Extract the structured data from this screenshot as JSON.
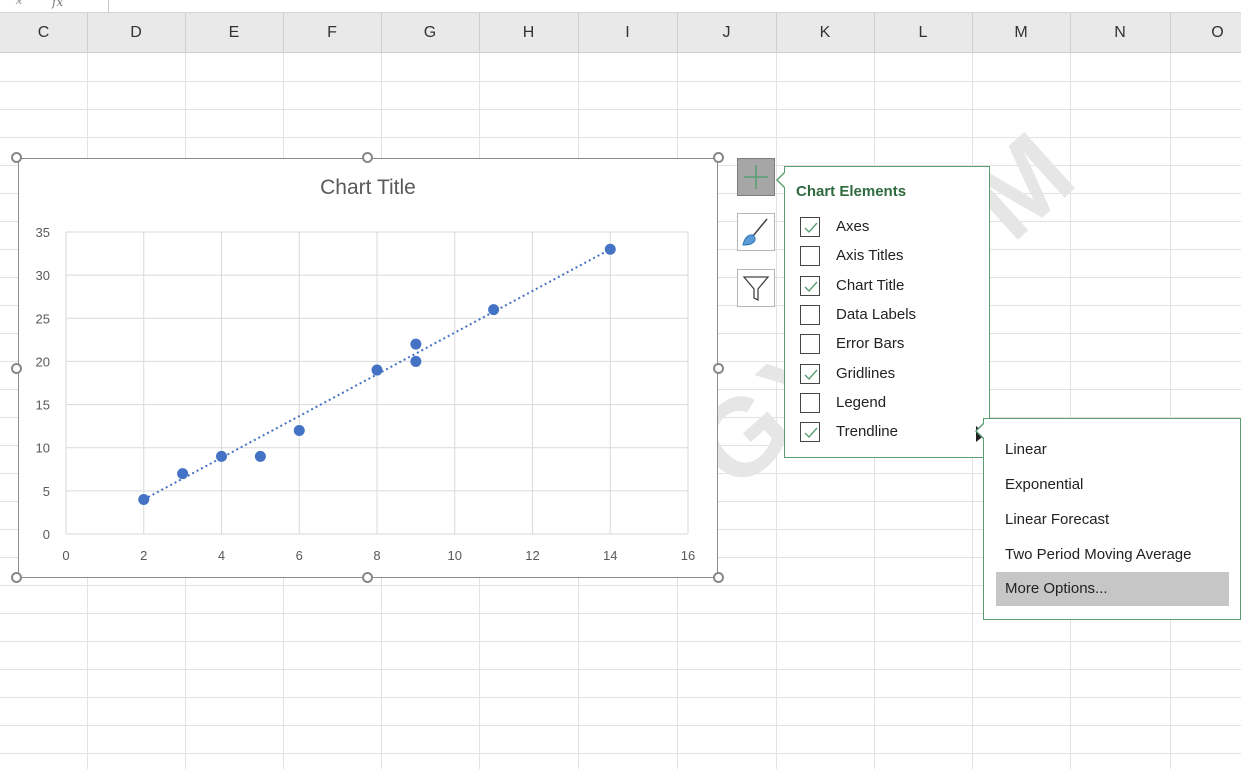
{
  "columns": [
    "C",
    "D",
    "E",
    "F",
    "G",
    "H",
    "I",
    "J",
    "K",
    "L",
    "M",
    "N",
    "O"
  ],
  "chart": {
    "title": "Chart Title"
  },
  "chart_data": {
    "type": "scatter",
    "title": "Chart Title",
    "xlabel": "",
    "ylabel": "",
    "xlim": [
      0,
      16
    ],
    "ylim": [
      0,
      35
    ],
    "x_ticks": [
      0,
      2,
      4,
      6,
      8,
      10,
      12,
      14,
      16
    ],
    "y_ticks": [
      0,
      5,
      10,
      15,
      20,
      25,
      30,
      35
    ],
    "grid": true,
    "legend": false,
    "series": [
      {
        "x": [
          2,
          3,
          4,
          5,
          6,
          8,
          9,
          9,
          11,
          14
        ],
        "y": [
          4,
          7,
          9,
          9,
          12,
          19,
          22,
          20,
          26,
          33
        ],
        "color": "#4472c4"
      }
    ],
    "trendline": {
      "type": "linear",
      "style": "dotted",
      "color": "#4472c4",
      "from": [
        2,
        4
      ],
      "to": [
        14,
        33
      ]
    }
  },
  "side_buttons": {
    "elements_icon": "plus-icon",
    "styles_icon": "brush-icon",
    "filter_icon": "funnel-icon"
  },
  "chart_elements": {
    "title": "Chart Elements",
    "items": [
      {
        "label": "Axes",
        "checked": true
      },
      {
        "label": "Axis Titles",
        "checked": false
      },
      {
        "label": "Chart Title",
        "checked": true
      },
      {
        "label": "Data Labels",
        "checked": false
      },
      {
        "label": "Error Bars",
        "checked": false
      },
      {
        "label": "Gridlines",
        "checked": true
      },
      {
        "label": "Legend",
        "checked": false
      },
      {
        "label": "Trendline",
        "checked": true
      }
    ]
  },
  "trendline_menu": {
    "items": [
      "Linear",
      "Exponential",
      "Linear Forecast",
      "Two Period Moving Average",
      "More Options..."
    ],
    "highlighted": "More Options..."
  },
  "watermark": "OGY.COM",
  "colors": {
    "accent_green": "#2f6b3f",
    "series_blue": "#4472c4"
  }
}
